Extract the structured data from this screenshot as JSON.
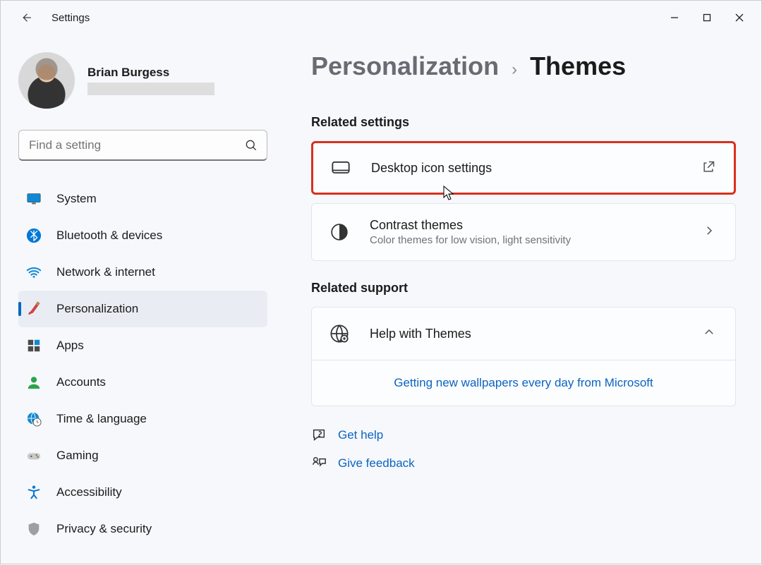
{
  "titlebar": {
    "title": "Settings"
  },
  "user": {
    "name": "Brian Burgess"
  },
  "search": {
    "placeholder": "Find a setting"
  },
  "nav": [
    {
      "label": "System",
      "icon": "monitor",
      "active": false
    },
    {
      "label": "Bluetooth & devices",
      "icon": "bluetooth",
      "active": false
    },
    {
      "label": "Network & internet",
      "icon": "wifi",
      "active": false
    },
    {
      "label": "Personalization",
      "icon": "brush",
      "active": true
    },
    {
      "label": "Apps",
      "icon": "apps",
      "active": false
    },
    {
      "label": "Accounts",
      "icon": "person",
      "active": false
    },
    {
      "label": "Time & language",
      "icon": "globe-time",
      "active": false
    },
    {
      "label": "Gaming",
      "icon": "gamepad",
      "active": false
    },
    {
      "label": "Accessibility",
      "icon": "access",
      "active": false
    },
    {
      "label": "Privacy & security",
      "icon": "shield",
      "active": false
    }
  ],
  "breadcrumb": {
    "parent": "Personalization",
    "current": "Themes"
  },
  "sections": {
    "related_settings": "Related settings",
    "related_support": "Related support"
  },
  "cards": [
    {
      "title": "Desktop icon settings",
      "subtitle": "",
      "action": "open-external",
      "highlight": true
    },
    {
      "title": "Contrast themes",
      "subtitle": "Color themes for low vision, light sensitivity",
      "action": "chevron",
      "highlight": false
    }
  ],
  "support": {
    "title": "Help with Themes",
    "link": "Getting new wallpapers every day from Microsoft"
  },
  "footer": {
    "help": "Get help",
    "feedback": "Give feedback"
  }
}
